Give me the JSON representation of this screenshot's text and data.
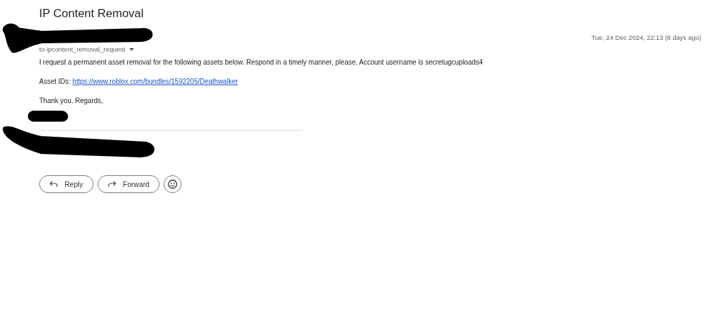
{
  "subject": "IP Content Removal",
  "date": "Tue, 24 Dec 2024, 22:13 (8 days ago)",
  "recipient": "to ipcontent_removal_request",
  "body": [
    {
      "kind": "text",
      "text": "I request a permanent asset removal for the following assets below. Respond in a timely manner, please. Account username is secretugcuploads4"
    },
    {
      "kind": "link",
      "label": "Asset IDs:",
      "url": "https://www.roblox.com/bundles/1592205/Deathwalker"
    },
    {
      "kind": "text",
      "text": "Thank you. Regards,"
    }
  ],
  "actions": [
    {
      "kind": "reply",
      "label": "Reply"
    },
    {
      "kind": "forward",
      "label": "Forward"
    },
    {
      "kind": "emoji"
    }
  ]
}
